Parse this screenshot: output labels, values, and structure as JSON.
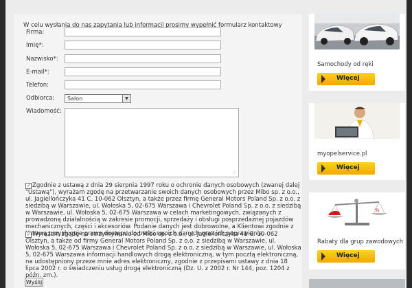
{
  "form": {
    "intro": "W celu wysłania do nas zapytania lub informacji prosimy wypełnić formularz kontaktowy",
    "labels": {
      "firma": "Firma:",
      "imie": "Imię*:",
      "nazwisko": "Nazwisko*:",
      "email": "E-mail*:",
      "telefon": "Telefon:",
      "odbiorca": "Odbiorca:",
      "wiadomosc": "Wiadomość:"
    },
    "values": {
      "firma": "",
      "imie": "",
      "nazwisko": "",
      "email": "",
      "telefon": "",
      "wiadomosc": ""
    },
    "odbiorca_selected": "Salon",
    "consent1": {
      "checked": true,
      "text": "Zgodnie z ustawą z dnia 29 sierpnia 1997 roku o ochronie danych osobowych (zwanej dalej \"Ustawą\"), wyrażam zgodę na przetwarzanie swoich danych osobowych przez Mibo sp. z o.o., ul. Jagiellończyka 41 C. 10-062 Olsztyn, a także przez firmę General Motors Poland Sp. z o.o. z siedzibą w Warszawie, ul. Wołoska 5, 02-675 Warszawa i Chevrolet Poland Sp. z o.o. z siedzibą w Warszawie, ul. Wołoska 5, 02-675 Warszawa w celach marketingowych, związanych z prowadzoną działalnością w zakresie promocji, sprzedaży i obsługi posprzedażnej pojazdów mechanicznych, części i akcesoriów. Podanie danych jest dobrowolne, a Klientowi zgodnie z Ustawą przysługuje prawo dostępu do treści swoich danych oraz ich poprawiania."
    },
    "consent2": {
      "checked": true,
      "text": "Wyrażam zgodę na otrzymywanie od Mibo sp. z o.o., ul. Jagiellończyka 41 C. 10-062 Olsztyn, a także od firmy General Motors Poland Sp. z o.o. z siedzibą w Warszawie, ul. Wołoska 5, 02-675 Warszawa i Chevrolet Poland Sp. z o.o. z siedzibą w Warszawie, ul. Wołoska 5, 02-675 Warszawa informacji handlowych drogą elektroniczną, w tym pocztą elektroniczną, na udostępniony przeze mnie adres elektroniczny, zgodnie z przepisami ustawy z dnia 18 lipca 2002 r. o świadczeniu usług drogą elektroniczną (Dz. U. z 2002 r. Nr 144, poz. 1204 z późn. zm.)."
    },
    "submit_label": "Wyślij"
  },
  "sidebar": {
    "promos": [
      {
        "caption": "Samochody od ręki",
        "button": "Więcej",
        "image": "car-showroom"
      },
      {
        "caption": "myopelservice.pl",
        "button": "Więcej",
        "image": "service-advisor"
      },
      {
        "caption": "Rabaty dla grup zawodowych",
        "button": "Więcej",
        "image": "scale-with-car"
      }
    ]
  },
  "colors": {
    "button_yellow": "#f7b900",
    "frame": "#2a2a2a",
    "panel": "#f4f4f4"
  }
}
